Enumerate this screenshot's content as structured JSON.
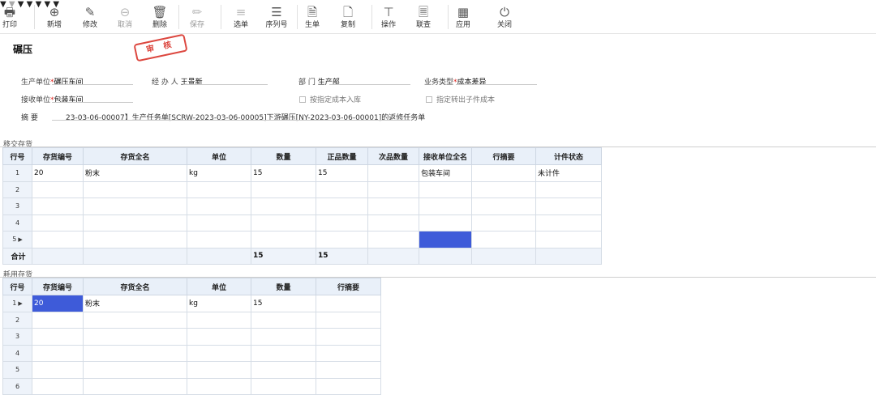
{
  "toolbar": {
    "print": "打印",
    "add": "新增",
    "edit": "修改",
    "cancel": "取消",
    "delete": "删除",
    "save": "保存",
    "select": "选单",
    "serial": "序列号",
    "generate": "生单",
    "copy": "复制",
    "operate": "操作",
    "query": "联查",
    "apply": "应用",
    "close": "关闭"
  },
  "doc": {
    "title": "碾压",
    "stamp": "审 核"
  },
  "form": {
    "prod_unit_label": "生产单位",
    "prod_unit": "碾压车间",
    "handler_label": "经 办 人",
    "handler": "王景新",
    "dept_label": "部    门",
    "dept": "生产部",
    "biz_type_label": "业务类型",
    "biz_type": "成本差异",
    "recv_unit_label": "接收单位",
    "recv_unit": "包装车间",
    "chk_cost_in": "按指定成本入库",
    "chk_sub_cost": "指定转出子件成本",
    "memo_label": "摘    要",
    "memo": "23-03-06-00007】生产任务单[SCRW-2023-03-06-00005]下游碾压[NY-2023-03-06-00001]的返修任务单"
  },
  "transfer": {
    "title": "移交存货",
    "headers": [
      "行号",
      "存货编号",
      "存货全名",
      "单位",
      "数量",
      "正品数量",
      "次品数量",
      "接收单位全名",
      "行摘要",
      "计件状态"
    ],
    "rows": [
      [
        "1",
        "20",
        "粉末",
        "kg",
        "15",
        "15",
        "",
        "包装车间",
        "",
        "未计件"
      ],
      [
        "2",
        "",
        "",
        "",
        "",
        "",
        "",
        "",
        "",
        ""
      ],
      [
        "3",
        "",
        "",
        "",
        "",
        "",
        "",
        "",
        "",
        ""
      ],
      [
        "4",
        "",
        "",
        "",
        "",
        "",
        "",
        "",
        "",
        ""
      ],
      [
        "5",
        "",
        "",
        "",
        "",
        "",
        "",
        "",
        "",
        ""
      ]
    ],
    "sum": [
      "合计",
      "",
      "",
      "",
      "15",
      "15",
      "",
      "",
      "",
      ""
    ]
  },
  "consume": {
    "title": "耗用存货",
    "headers": [
      "行号",
      "存货编号",
      "存货全名",
      "单位",
      "数量",
      "行摘要"
    ],
    "rows": [
      [
        "1",
        "20",
        "粉末",
        "kg",
        "15",
        ""
      ],
      [
        "2",
        "",
        "",
        "",
        "",
        ""
      ],
      [
        "3",
        "",
        "",
        "",
        "",
        ""
      ],
      [
        "4",
        "",
        "",
        "",
        "",
        ""
      ],
      [
        "5",
        "",
        "",
        "",
        "",
        ""
      ],
      [
        "6",
        "",
        "",
        "",
        "",
        ""
      ]
    ]
  }
}
